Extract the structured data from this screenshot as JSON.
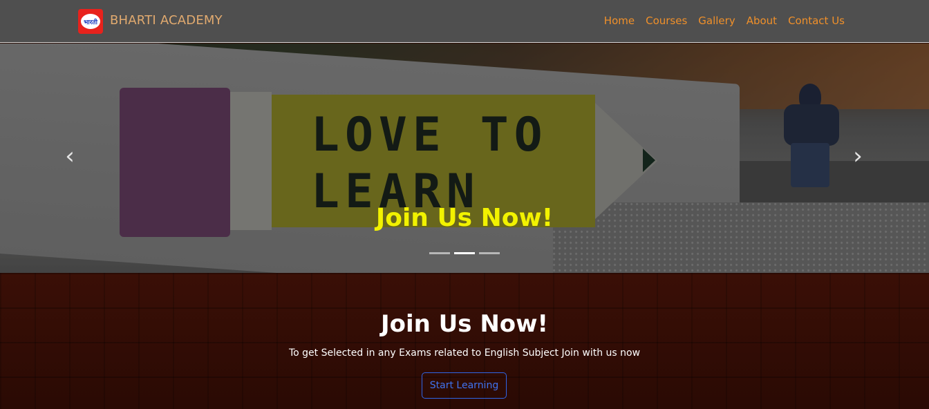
{
  "navbar": {
    "brand_name": "BHARTI ACADEMY",
    "logo_text": "भारती",
    "links": [
      {
        "label": "Home"
      },
      {
        "label": "Courses"
      },
      {
        "label": "Gallery"
      },
      {
        "label": "About"
      },
      {
        "label": "Contact Us"
      }
    ]
  },
  "hero": {
    "image_text": "LOVE TO LEARN",
    "caption": "Join Us Now!",
    "prev_icon": "‹",
    "next_icon": "›",
    "slide_count": 3,
    "active_slide": 2
  },
  "join": {
    "title": "Join Us Now!",
    "text": "To get Selected in any Exams related to English Subject Join with us now",
    "button_label": "Start Learning"
  },
  "colors": {
    "nav_link": "#f0902a",
    "brand": "#e1aa6f",
    "caption": "#f2f200",
    "button": "#2f66e8"
  }
}
